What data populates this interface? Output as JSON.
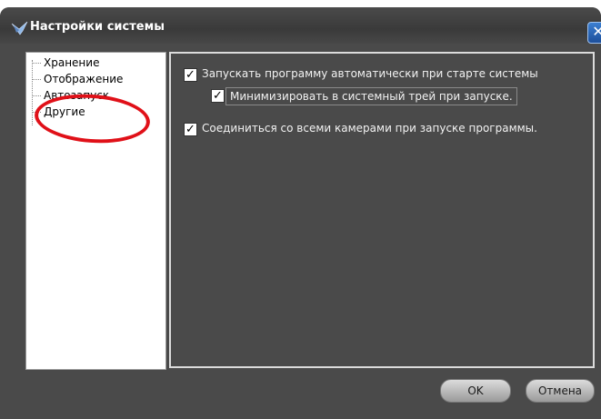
{
  "window": {
    "title": "Настройки системы",
    "close_glyph": "✕"
  },
  "sidebar": {
    "items": [
      {
        "label": "Хранение"
      },
      {
        "label": "Отображение"
      },
      {
        "label": "Автозапуск"
      },
      {
        "label": "Другие"
      }
    ]
  },
  "options": [
    {
      "label": "Запускать программу автоматически при старте системы",
      "checked": true
    },
    {
      "label": "Минимизировать в системный трей при запуске.",
      "checked": true
    },
    {
      "label": "Соединиться со всеми камерами при запуске программы.",
      "checked": true
    }
  ],
  "buttons": {
    "ok_label": "OK",
    "cancel_label": "Отмена"
  },
  "colors": {
    "annotation": "#e01018",
    "background": "#4a4a4a"
  },
  "icons": {
    "app": "bird-logo-icon",
    "check": "✓"
  }
}
